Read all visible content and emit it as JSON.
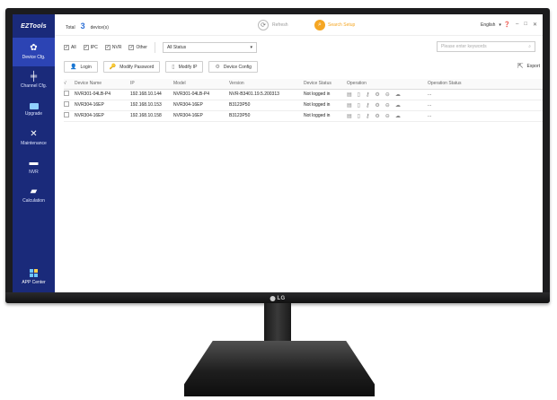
{
  "sidebar": {
    "logo": "EZTools",
    "items": [
      {
        "label": "Device Cfg.",
        "icon": "gear-icon",
        "active": true
      },
      {
        "label": "Channel Cfg.",
        "icon": "sliders-icon",
        "active": false
      },
      {
        "label": "Upgrade",
        "icon": "upgrade-icon",
        "active": false
      },
      {
        "label": "Maintenance",
        "icon": "tools-icon",
        "active": false
      },
      {
        "label": "NVR",
        "icon": "nvr-icon",
        "active": false
      },
      {
        "label": "Calculation",
        "icon": "calculation-icon",
        "active": false
      }
    ],
    "app_center": "APP Center"
  },
  "topbar": {
    "total_label": "Total",
    "total_count": "3",
    "total_unit": "device(s)",
    "refresh": "Refresh",
    "search_setup": "Search Setup",
    "language": "English"
  },
  "filters": {
    "all": "All",
    "ipc": "IPC",
    "nvr": "NVR",
    "other": "Other",
    "status": "All Status",
    "search_placeholder": "Please enter keywords"
  },
  "actions": {
    "login": "Login",
    "modify_password": "Modify Password",
    "modify_ip": "Modify IP",
    "device_config": "Device Config",
    "export": "Export"
  },
  "table": {
    "columns": [
      "√",
      "Device Name",
      "IP",
      "Model",
      "Version",
      "Device Status",
      "Operation",
      "Operation Status"
    ],
    "rows": [
      {
        "name": "NVR301-04LB-P4",
        "ip": "192.168.10.144",
        "model": "NVR301-04LB-P4",
        "version": "NVR-B3401.19.5.200313",
        "status": "Not logged in",
        "op_status": "..."
      },
      {
        "name": "NVR304-16EP",
        "ip": "192.168.10.153",
        "model": "NVR304-16EP",
        "version": "B3123P50",
        "status": "Not logged in",
        "op_status": "..."
      },
      {
        "name": "NVR304-16EP",
        "ip": "192.168.10.158",
        "model": "NVR304-16EP",
        "version": "B3123P50",
        "status": "Not logged in",
        "op_status": "..."
      }
    ]
  },
  "monitor": {
    "brand": "LG"
  },
  "colors": {
    "sidebar": "#1a2a7a",
    "sidebar_active": "#2c44b4",
    "accent_blue": "#2c6fd6",
    "accent_orange": "#f5a623"
  }
}
